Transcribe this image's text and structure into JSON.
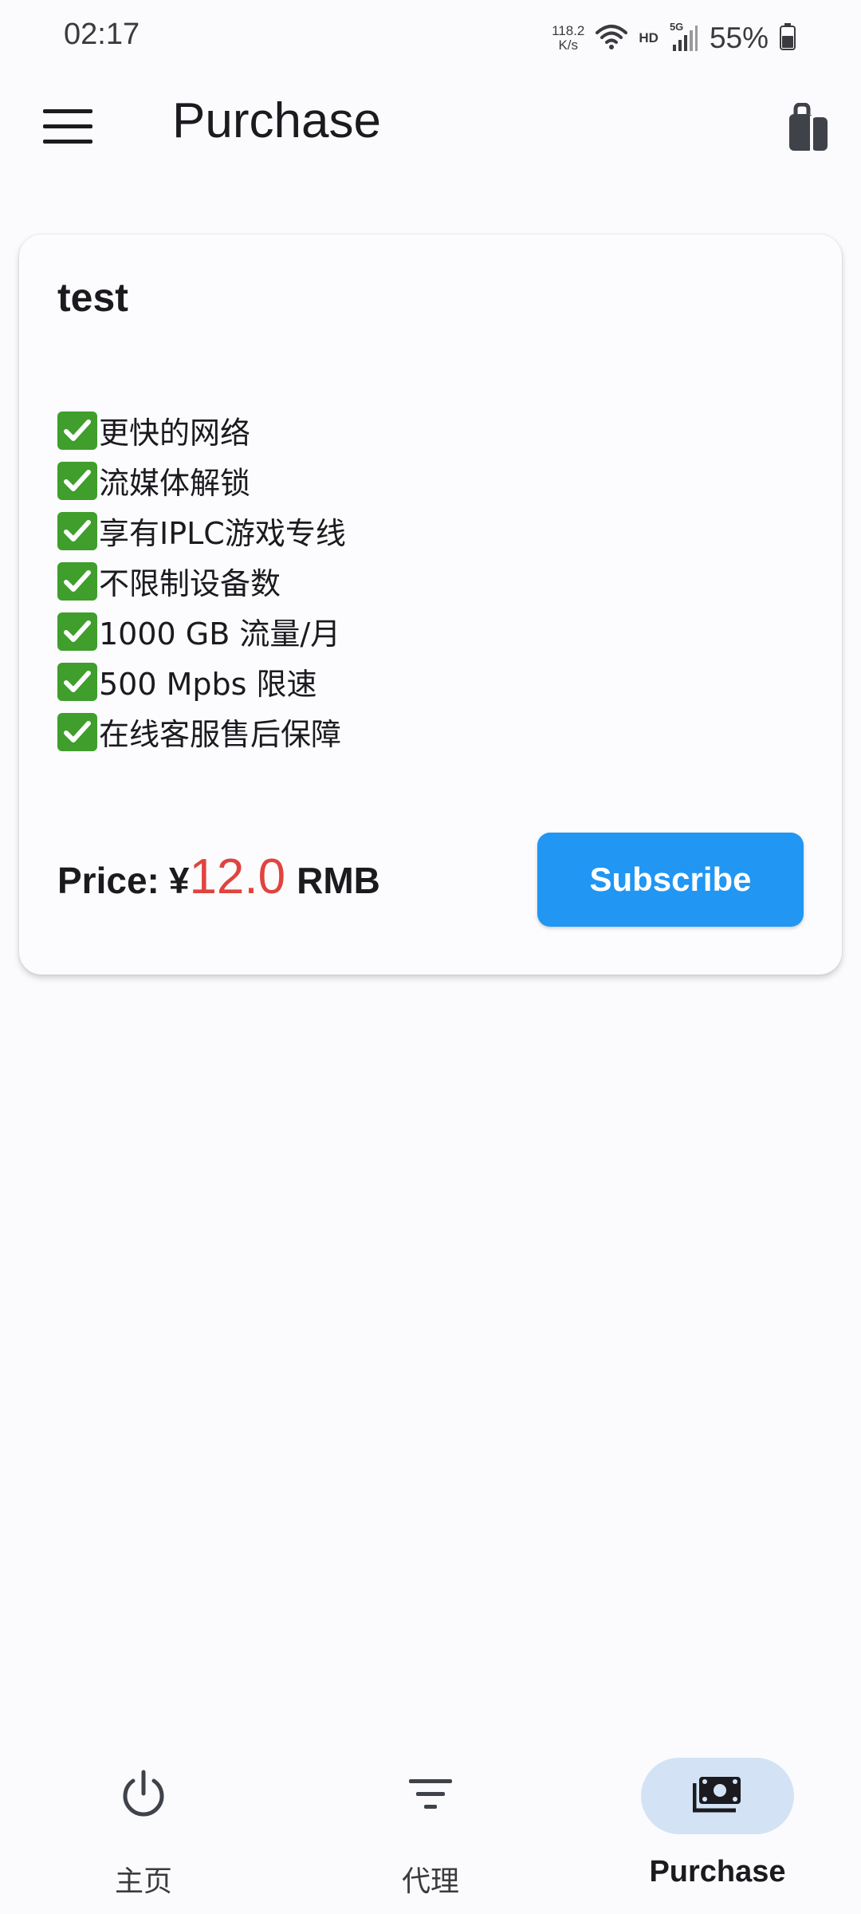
{
  "status_bar": {
    "time": "02:17",
    "net_speed_value": "118.2",
    "net_speed_unit": "K/s",
    "hd_label": "HD",
    "network_label": "5G",
    "battery": "55%"
  },
  "app_bar": {
    "title": "Purchase",
    "menu_icon": "menu-icon",
    "right_icon": "shopping-bag-icon"
  },
  "plan": {
    "name": "test",
    "features": [
      "更快的网络",
      "流媒体解锁",
      "享有IPLC游戏专线",
      "不限制设备数",
      "1000 GB 流量/月",
      "500 Mpbs 限速",
      "在线客服售后保障"
    ],
    "price_label": "Price:",
    "currency_symbol": "¥",
    "price_value": "12.0",
    "price_unit": "RMB",
    "subscribe_label": "Subscribe"
  },
  "bottom_nav": {
    "items": [
      {
        "label": "主页",
        "icon": "power-icon",
        "active": false
      },
      {
        "label": "代理",
        "icon": "filter-list-icon",
        "active": false
      },
      {
        "label": "Purchase",
        "icon": "money-icon",
        "active": true
      }
    ]
  },
  "colors": {
    "accent": "#2196f3",
    "price": "#e0443e",
    "check": "#3f9e2c",
    "nav_active_bg": "#d3e3f5"
  }
}
